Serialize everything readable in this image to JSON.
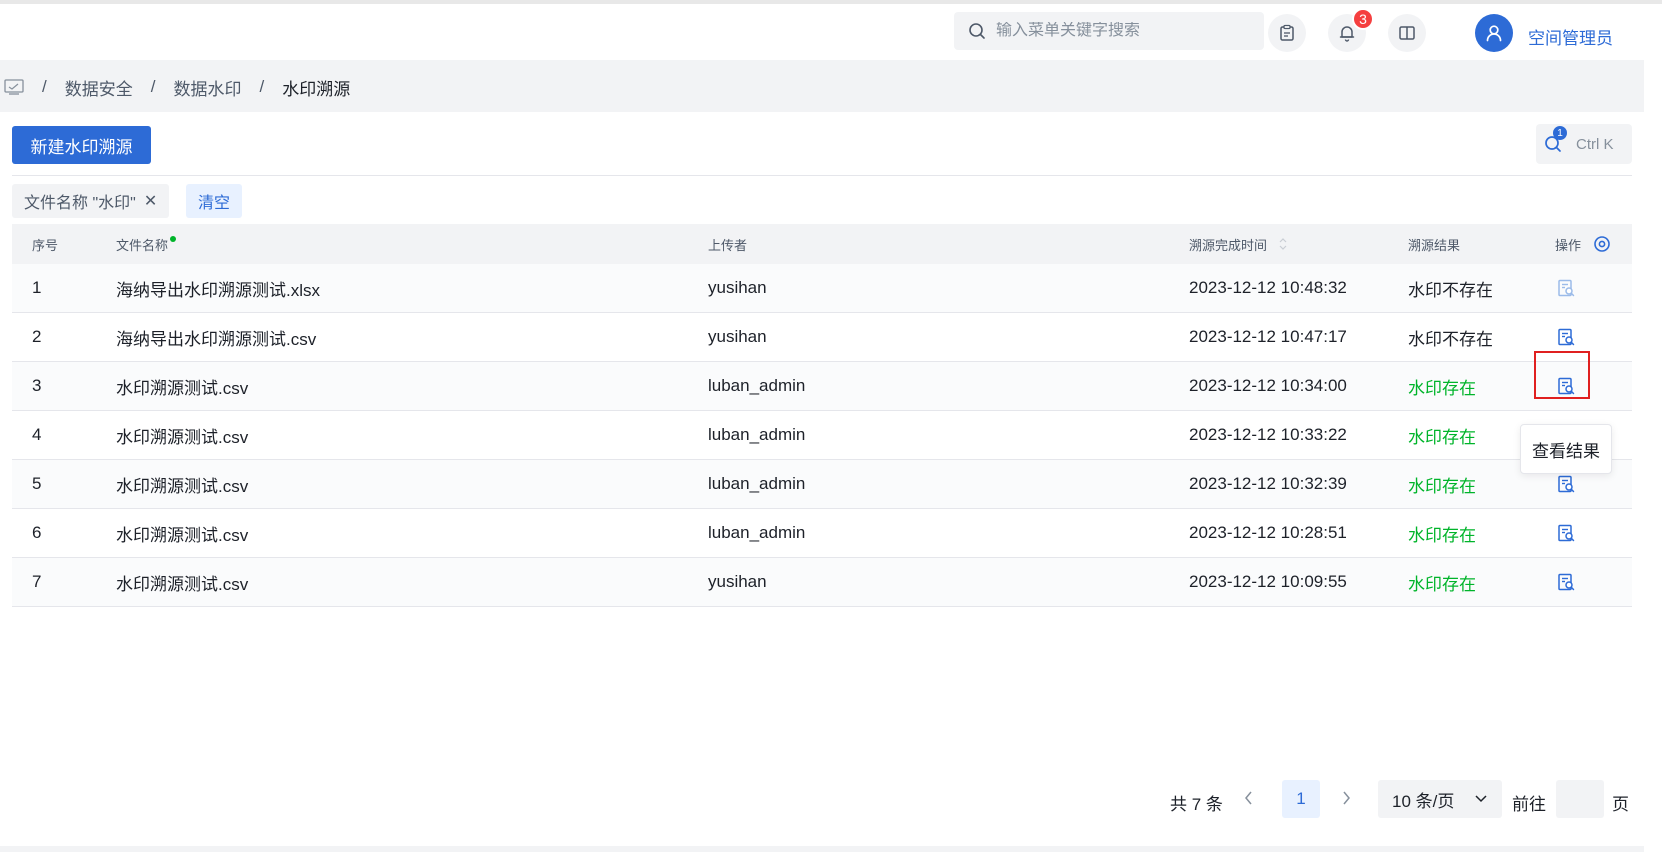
{
  "header": {
    "search_placeholder": "输入菜单关键字搜索",
    "notification_count": "3",
    "username": "空间管理员"
  },
  "breadcrumb": {
    "items": [
      "数据安全",
      "数据水印",
      "水印溯源"
    ]
  },
  "toolbar": {
    "new_button": "新建水印溯源",
    "shortcut_badge": "1",
    "shortcut_label": "Ctrl K"
  },
  "filter": {
    "tag": "文件名称 \"水印\"",
    "clear": "清空"
  },
  "table": {
    "columns": {
      "index": "序号",
      "name": "文件名称",
      "uploader": "上传者",
      "time": "溯源完成时间",
      "result": "溯源结果",
      "op": "操作"
    },
    "rows": [
      {
        "index": "1",
        "name": "海纳导出水印溯源测试.xlsx",
        "uploader": "yusihan",
        "time": "2023-12-12 10:48:32",
        "result": "水印不存在",
        "found": false
      },
      {
        "index": "2",
        "name": "海纳导出水印溯源测试.csv",
        "uploader": "yusihan",
        "time": "2023-12-12 10:47:17",
        "result": "水印不存在",
        "found": false
      },
      {
        "index": "3",
        "name": "水印溯源测试.csv",
        "uploader": "luban_admin",
        "time": "2023-12-12 10:34:00",
        "result": "水印存在",
        "found": true
      },
      {
        "index": "4",
        "name": "水印溯源测试.csv",
        "uploader": "luban_admin",
        "time": "2023-12-12 10:33:22",
        "result": "水印存在",
        "found": true
      },
      {
        "index": "5",
        "name": "水印溯源测试.csv",
        "uploader": "luban_admin",
        "time": "2023-12-12 10:32:39",
        "result": "水印存在",
        "found": true
      },
      {
        "index": "6",
        "name": "水印溯源测试.csv",
        "uploader": "luban_admin",
        "time": "2023-12-12 10:28:51",
        "result": "水印存在",
        "found": true
      },
      {
        "index": "7",
        "name": "水印溯源测试.csv",
        "uploader": "yusihan",
        "time": "2023-12-12 10:09:55",
        "result": "水印存在",
        "found": true
      }
    ]
  },
  "tooltip": "查看结果",
  "pagination": {
    "total": "共 7 条",
    "current_page": "1",
    "page_size": "10 条/页",
    "goto_label": "前往",
    "goto_value": "",
    "page_unit": "页"
  },
  "colors": {
    "primary": "#2d6bd6",
    "success": "#00b42a",
    "danger": "#f53f3f"
  }
}
